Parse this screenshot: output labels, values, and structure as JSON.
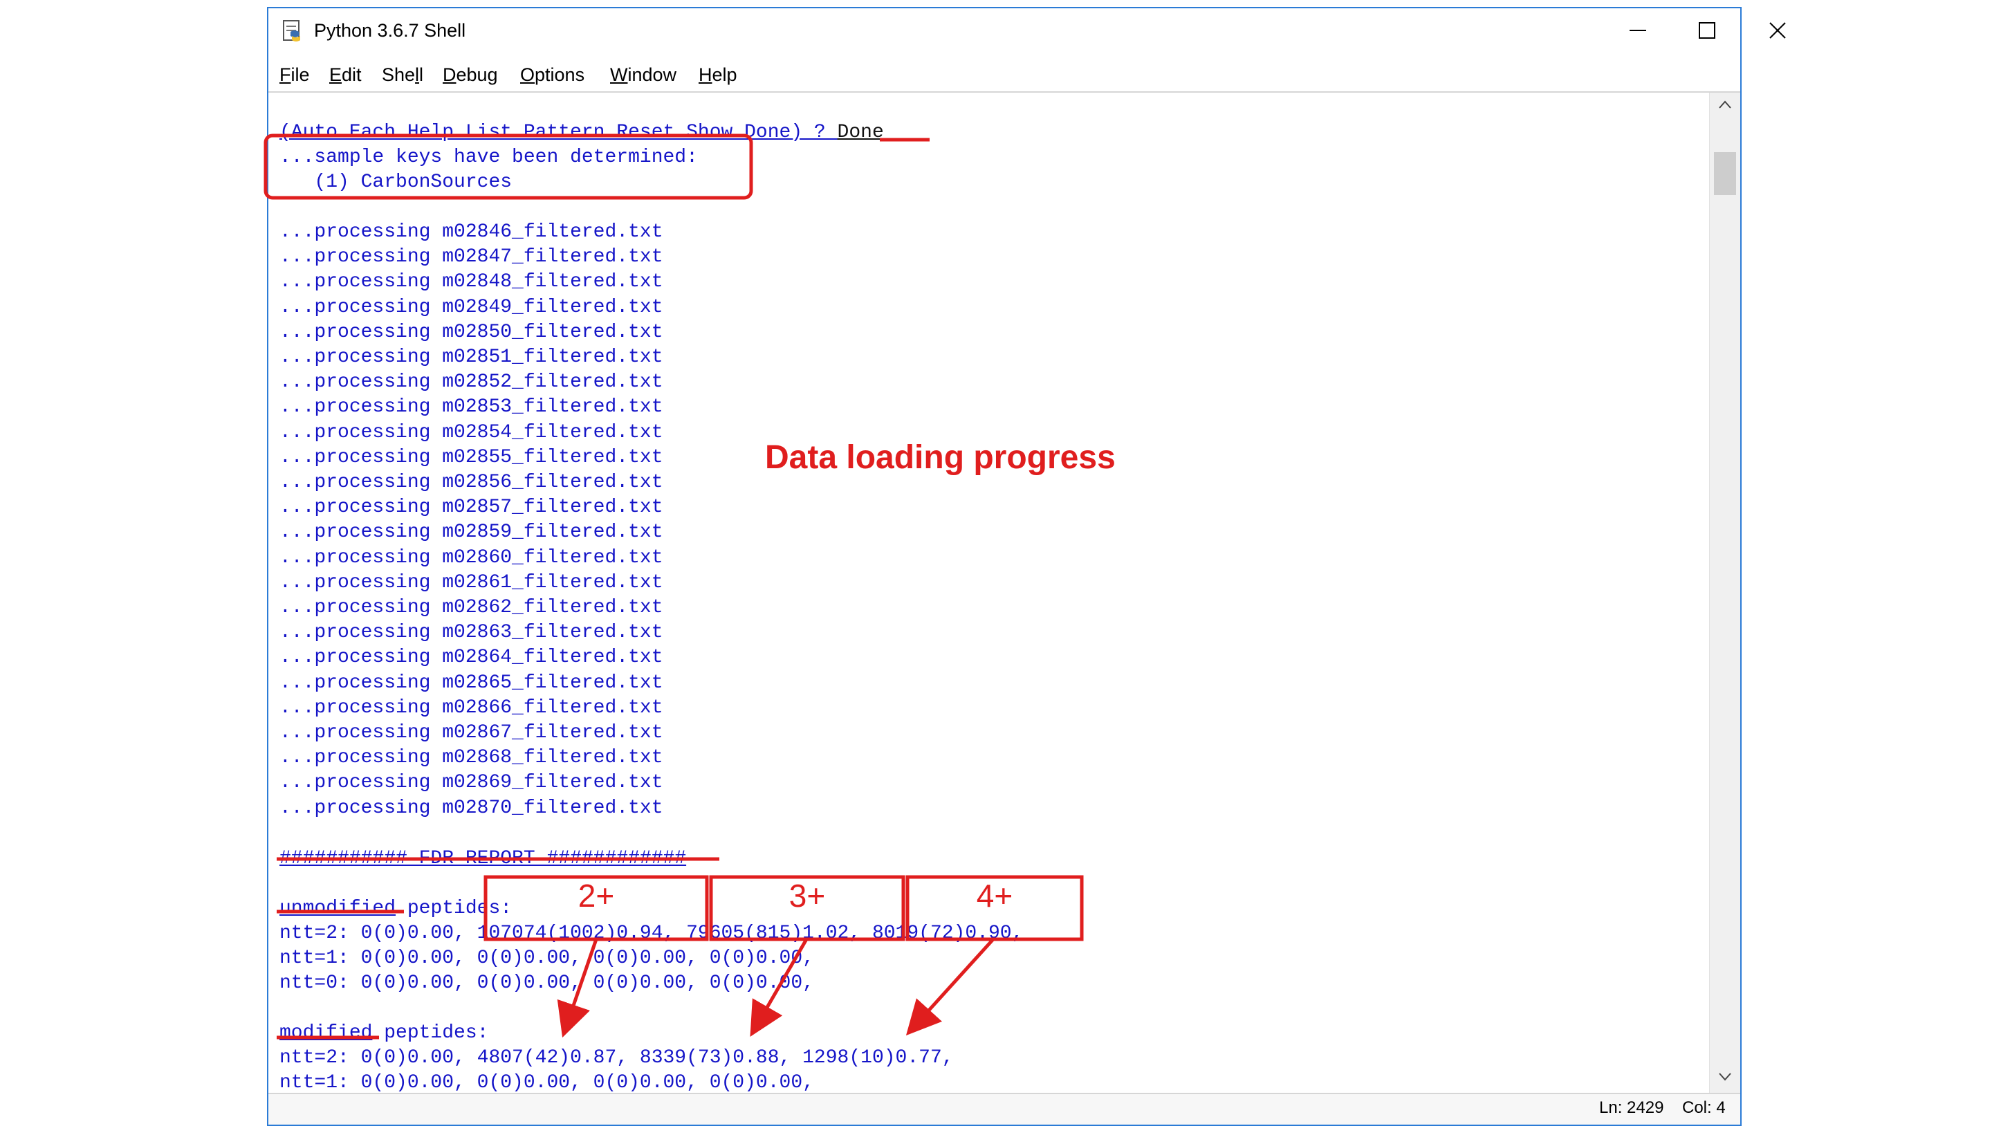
{
  "window": {
    "title": "Python 3.6.7 Shell",
    "controls": [
      "minimize",
      "maximize",
      "close"
    ]
  },
  "menu": [
    {
      "mnemonic": "F",
      "rest": "ile"
    },
    {
      "mnemonic": "E",
      "rest": "dit"
    },
    {
      "pre": "She",
      "mnemonic": "l",
      "rest": "l"
    },
    {
      "mnemonic": "D",
      "rest": "ebug"
    },
    {
      "mnemonic": "O",
      "rest": "ptions"
    },
    {
      "mnemonic": "W",
      "rest": "indow"
    },
    {
      "mnemonic": "H",
      "rest": "elp"
    }
  ],
  "shell": {
    "prompt_line": "(Auto Each Help List Pattern Reset Show Done) ? ",
    "prompt_answer": "Done",
    "keys_header": "...sample keys have been determined:",
    "keys_item": "   (1) CarbonSources",
    "processing": [
      "...processing m02846_filtered.txt",
      "...processing m02847_filtered.txt",
      "...processing m02848_filtered.txt",
      "...processing m02849_filtered.txt",
      "...processing m02850_filtered.txt",
      "...processing m02851_filtered.txt",
      "...processing m02852_filtered.txt",
      "...processing m02853_filtered.txt",
      "...processing m02854_filtered.txt",
      "...processing m02855_filtered.txt",
      "...processing m02856_filtered.txt",
      "...processing m02857_filtered.txt",
      "...processing m02859_filtered.txt",
      "...processing m02860_filtered.txt",
      "...processing m02861_filtered.txt",
      "...processing m02862_filtered.txt",
      "...processing m02863_filtered.txt",
      "...processing m02864_filtered.txt",
      "...processing m02865_filtered.txt",
      "...processing m02866_filtered.txt",
      "...processing m02867_filtered.txt",
      "...processing m02868_filtered.txt",
      "...processing m02869_filtered.txt",
      "...processing m02870_filtered.txt"
    ],
    "fdr_header": "########### FDR REPORT ############",
    "unmodified_word": "unmodified",
    "unmodified_rest": " peptides:",
    "unmodified_lines": [
      "ntt=2: 0(0)0.00, 107074(1002)0.94, 79605(815)1.02, 8019(72)0.90,",
      "ntt=1: 0(0)0.00, 0(0)0.00, 0(0)0.00, 0(0)0.00,",
      "ntt=0: 0(0)0.00, 0(0)0.00, 0(0)0.00, 0(0)0.00,"
    ],
    "modified_word": "modified",
    "modified_rest": " peptides:",
    "modified_lines": [
      "ntt=2: 0(0)0.00, 4807(42)0.87, 8339(73)0.88, 1298(10)0.77,",
      "ntt=1: 0(0)0.00, 0(0)0.00, 0(0)0.00, 0(0)0.00,"
    ]
  },
  "status": {
    "line": "Ln: 2429",
    "col": "Col: 4"
  },
  "annotations": {
    "progress_label": "Data loading progress",
    "charge_labels": [
      "2+",
      "3+",
      "4+"
    ],
    "color": "#e01e1e"
  }
}
